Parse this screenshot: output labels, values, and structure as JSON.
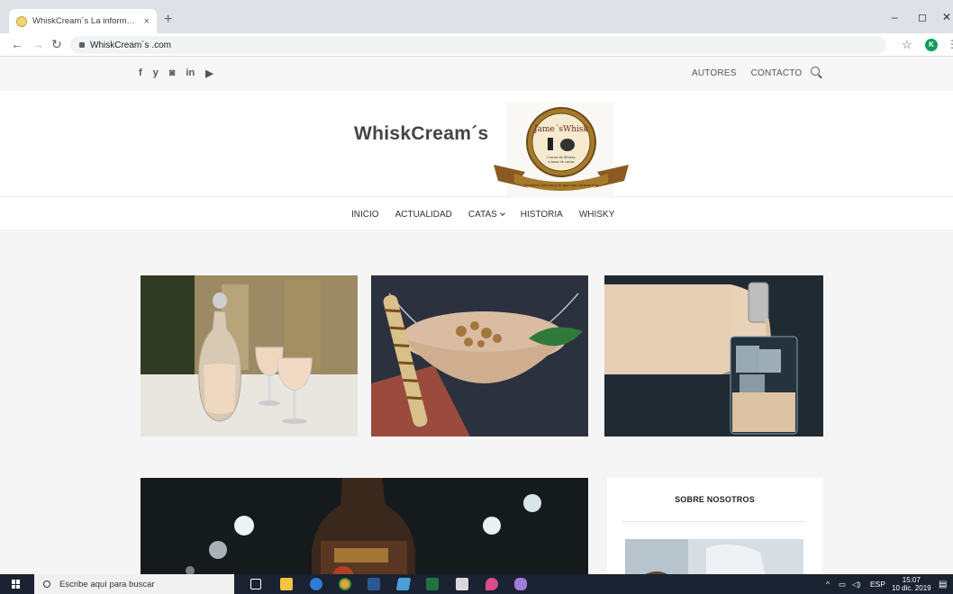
{
  "browser": {
    "tab_title": "WhiskCream´s La información para",
    "tab_close": "×",
    "new_tab": "+",
    "url": "WhiskCream´s .com",
    "window_controls": [
      "–",
      "◻",
      "✕"
    ],
    "profile_initial": "K"
  },
  "topbar": {
    "social": [
      "f",
      "y",
      "◙",
      "in",
      "▶"
    ],
    "links": [
      "AUTORES",
      "CONTACTO"
    ]
  },
  "header": {
    "brand": "WhiskCream´s",
    "logo_title": "Jame´sWhisk",
    "logo_line1": "Crema de Whisky",
    "logo_line2": "a base de cacao",
    "logo_ribbon": "Nuestra esencia y lo que nos caracteriza"
  },
  "nav": {
    "items": [
      "INICIO",
      "ACTUALIDAD",
      "CATAS",
      "HISTORIA",
      "WHISKY"
    ]
  },
  "sidebar": {
    "title": "SOBRE NOSOTROS"
  },
  "taskbar": {
    "search_placeholder": "Escribe aquí para buscar",
    "lang": "ESP",
    "time": "15:07",
    "date": "10 dic. 2019"
  },
  "colors": {
    "accent_gold": "#a57a2c",
    "taskbar_bg": "#1b2231"
  }
}
